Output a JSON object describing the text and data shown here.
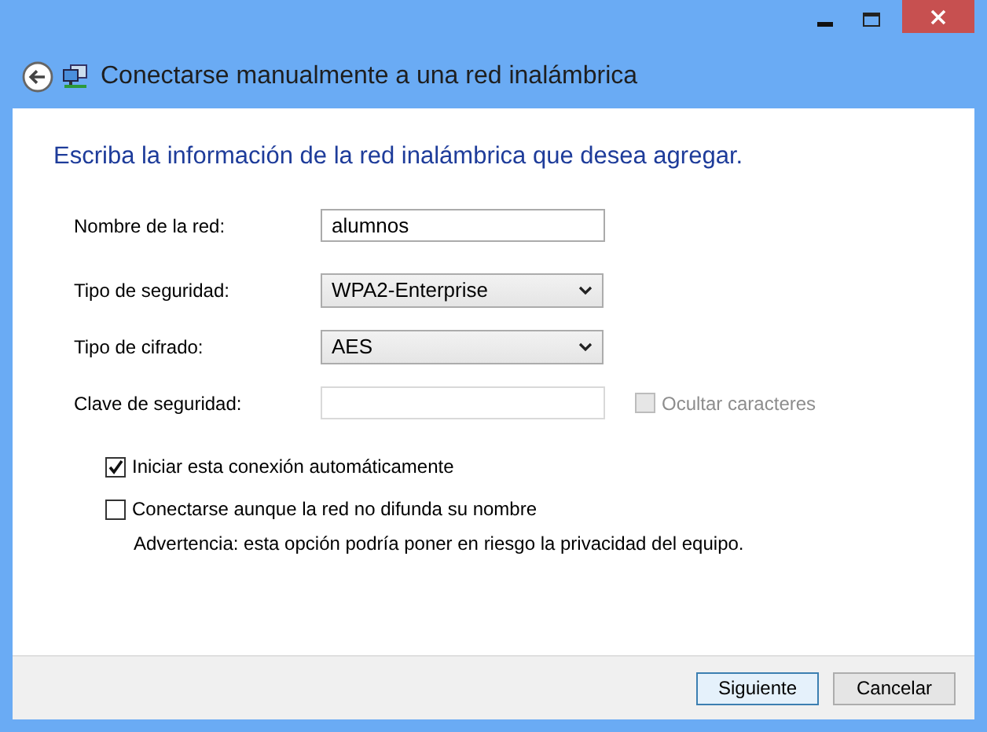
{
  "window": {
    "title": "Conectarse manualmente a una red inalámbrica"
  },
  "heading": "Escriba la información de la red inalámbrica que desea agregar.",
  "fields": [
    {
      "kind": "text",
      "label": "Nombre de la red:",
      "value": "alumnos",
      "disabled": false
    },
    {
      "kind": "dropdown",
      "label": "Tipo de seguridad:",
      "value": "WPA2-Enterprise",
      "disabled": false
    },
    {
      "kind": "dropdown",
      "label": "Tipo de cifrado:",
      "value": "AES",
      "disabled": false
    },
    {
      "kind": "text",
      "label": "Clave de seguridad:",
      "disabled": true,
      "option": {
        "label": "Ocultar caracteres",
        "checked": false,
        "disabled": true
      }
    }
  ],
  "options": [
    {
      "label": "Iniciar esta conexión automáticamente",
      "checked": true
    },
    {
      "label": "Conectarse aunque la red no difunda su nombre",
      "checked": false,
      "note": "Advertencia: esta opción podría poner en riesgo la privacidad del equipo."
    }
  ],
  "buttons": [
    {
      "label": "Siguiente",
      "default": true
    },
    {
      "label": "Cancelar",
      "default": false
    }
  ]
}
